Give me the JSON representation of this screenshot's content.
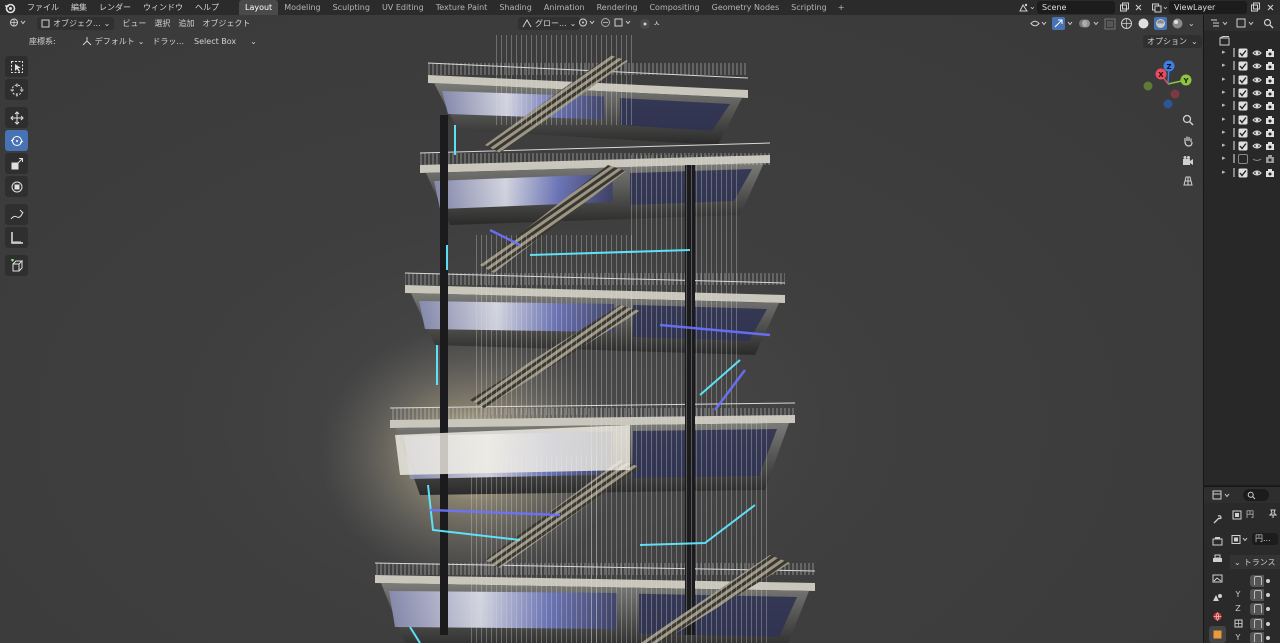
{
  "menu": {
    "file": "ファイル",
    "edit": "編集",
    "render": "レンダー",
    "window": "ウィンドウ",
    "help": "ヘルプ"
  },
  "workspaces": [
    "Layout",
    "Modeling",
    "Sculpting",
    "UV Editing",
    "Texture Paint",
    "Shading",
    "Animation",
    "Rendering",
    "Compositing",
    "Geometry Nodes",
    "Scripting"
  ],
  "active_workspace": "Layout",
  "scene": {
    "name": "Scene",
    "view_layer": "ViewLayer"
  },
  "viewport_header": {
    "mode": "オブジェク...",
    "view": "ビュー",
    "select": "選択",
    "add": "追加",
    "object": "オブジェクト",
    "transform_orientation": "グロー...",
    "proportional": "ㅅ"
  },
  "viewport_sub": {
    "coord_label": "座標系:",
    "coord_value": "デフォルト",
    "drag_label": "ドラッ...",
    "drag_value": "Select Box",
    "options": "オプション"
  },
  "gizmo": {
    "x": "X",
    "y": "Y",
    "z": "Z"
  },
  "properties": {
    "object_name": "円",
    "data_name": "円...",
    "transform_header": "トランス",
    "axis_y": "Y",
    "axis_z": "Z",
    "axis_y2": "Y"
  },
  "colors": {
    "accent": "#4772b3",
    "header_bg": "#2b2b2b",
    "viewport_bg": "#3d3d3d",
    "neon_cyan": "#5fe8ff",
    "neon_blue": "#5a70ff"
  }
}
